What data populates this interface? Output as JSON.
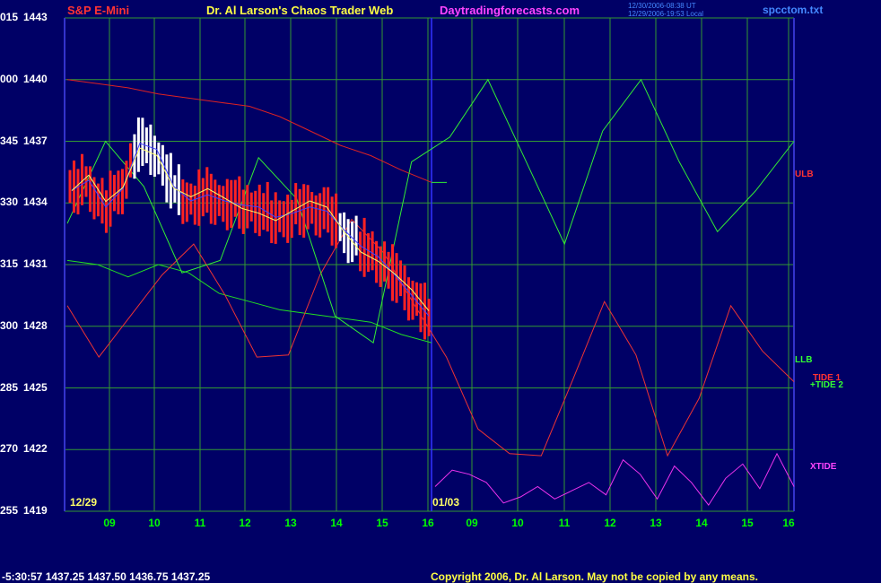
{
  "header": {
    "symbol": "S&P E-Mini",
    "title": "Dr. Al Larson's Chaos Trader Web",
    "site": "Daytradingforecasts.com",
    "stamp_line1": "12/30/2006-08:38 UT",
    "stamp_line2": "12/29/2006-19:53 Local",
    "file": "spcctom.txt"
  },
  "yaxis_labels": [
    {
      "left": "015",
      "right": "1443"
    },
    {
      "left": "000",
      "right": "1440"
    },
    {
      "left": "345",
      "right": "1437"
    },
    {
      "left": "330",
      "right": "1434"
    },
    {
      "left": "315",
      "right": "1431"
    },
    {
      "left": "300",
      "right": "1428"
    },
    {
      "left": "285",
      "right": "1425"
    },
    {
      "left": "270",
      "right": "1422"
    },
    {
      "left": "255",
      "right": "1419"
    }
  ],
  "xaxis_labels": [
    "09",
    "10",
    "11",
    "12",
    "13",
    "14",
    "15",
    "16",
    "09",
    "10",
    "11",
    "12",
    "13",
    "14",
    "15",
    "16"
  ],
  "dates": {
    "left": "12/29",
    "right": "01/03"
  },
  "right_labels": {
    "ulb": "ULB",
    "llb": "LLB",
    "tide1": "TIDE 1",
    "tide2": "+TIDE 2",
    "xtide": "XTIDE"
  },
  "footer": {
    "quote": "-5:30:57  1437.25  1437.50  1436.75  1437.25",
    "copyright": "Copyright 2006, Dr. Al Larson. May not be copied by any means."
  },
  "colors": {
    "background": "#000066",
    "grid": "#339933",
    "price_bar": "#ff2222",
    "price_up": "#ffffff",
    "ulb": "#dd2222",
    "llb": "#22dd22",
    "tide1": "#ee3333",
    "tide2": "#33ee33",
    "xtide": "#ee33ee",
    "average": "#ffff66",
    "blue_average": "#4444ff"
  },
  "chart_data": {
    "type": "line",
    "title": "S&P E-Mini",
    "xlabel": "",
    "ylabel": "",
    "ylim": [
      1419,
      1443
    ],
    "x_ticks_hours": [
      9,
      10,
      11,
      12,
      13,
      14,
      15,
      16,
      9,
      10,
      11,
      12,
      13,
      14,
      15,
      16
    ],
    "series": [
      {
        "name": "ULB",
        "values": [
          1440,
          1439.8,
          1439.6,
          1439.3,
          1439.1,
          1438.9,
          1438.7,
          1438.2,
          1437.5,
          1436.8,
          1436.3,
          1435.6,
          1435
        ]
      },
      {
        "name": "LLB",
        "values": [
          1431.2,
          1431,
          1430.4,
          1431,
          1430.6,
          1429.6,
          1429.2,
          1428.8,
          1428.6,
          1428.4,
          1428.2,
          1427.6,
          1427.2
        ]
      },
      {
        "name": "TIDE 1",
        "values": [
          1429,
          1426.5,
          1428.5,
          1430.5,
          1432,
          1429.5,
          1426.5,
          1426.6,
          1430.5,
          1433.2,
          1431.6,
          1429,
          1426.5,
          1423,
          1421.8,
          1421.7,
          1425.4,
          1429.2,
          1426.6,
          1421.7,
          1424.5,
          1429,
          1426.8,
          1425.3
        ]
      },
      {
        "name": "TIDE 2",
        "values": [
          1433,
          1437,
          1434.8,
          1430.6,
          1431.2,
          1436.2,
          1434.2,
          1428.5,
          1427.2,
          1436,
          1437.2,
          1440,
          1436,
          1432,
          1437.5,
          1440,
          1436,
          1432.6,
          1434.6,
          1437
        ]
      },
      {
        "name": "XTIDE",
        "values": [
          1420.2,
          1421,
          1420.8,
          1420.4,
          1419.4,
          1419.7,
          1420.2,
          1419.6,
          1420,
          1420.4,
          1419.8,
          1421.5,
          1420.8,
          1419.6,
          1421.2,
          1420.4,
          1419.3,
          1420.6,
          1421.3,
          1420.1,
          1421.8,
          1420.2
        ]
      },
      {
        "name": "",
        "values": [
          1434.6,
          1435.1,
          1433.8,
          1434.7,
          1436.9,
          1436.6,
          1434.8,
          1434.1,
          1434.4,
          1434.1,
          1433.9,
          1433.8,
          1433.3,
          1433.5,
          1433.8,
          1433.6,
          1432.7,
          1431.9,
          1431.4,
          1430.5,
          1429.5,
          1428.5
        ]
      }
    ]
  }
}
